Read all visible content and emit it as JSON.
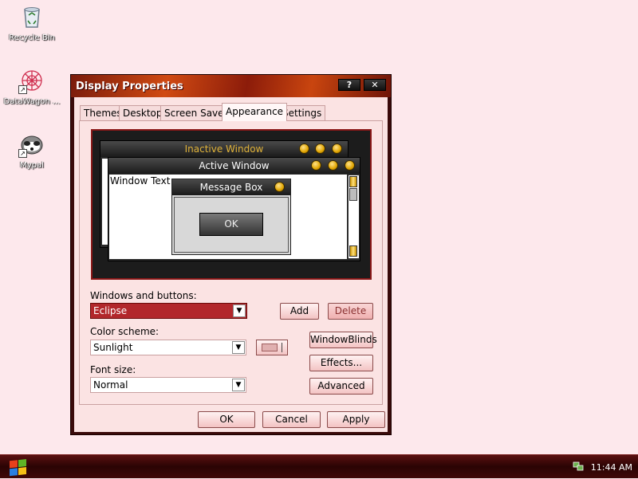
{
  "desktop": {
    "icons": [
      {
        "label": "Recycle Bin",
        "icon": "recycle-bin-icon"
      },
      {
        "label": "DataWagon ...",
        "icon": "datawagon-icon"
      },
      {
        "label": "Mypal",
        "icon": "mypal-icon"
      }
    ]
  },
  "window": {
    "title": "Display Properties",
    "help_label": "?",
    "close_label": "✕",
    "tabs": [
      {
        "label": "Themes"
      },
      {
        "label": "Desktop"
      },
      {
        "label": "Screen Saver"
      },
      {
        "label": "Appearance",
        "active": true
      },
      {
        "label": "Settings"
      }
    ],
    "preview": {
      "inactive_title": "Inactive Window",
      "active_title": "Active Window",
      "window_text": "Window Text",
      "message_box_title": "Message Box",
      "ok_label": "OK"
    },
    "windows_buttons": {
      "label": "Windows and buttons:",
      "value": "Eclipse"
    },
    "color_scheme": {
      "label": "Color scheme:",
      "value": "Sunlight"
    },
    "font_size": {
      "label": "Font size:",
      "value": "Normal"
    },
    "buttons": {
      "add": "Add",
      "delete": "Delete",
      "windowblinds": "WindowBlinds",
      "effects": "Effects...",
      "advanced": "Advanced"
    },
    "footer": {
      "ok": "OK",
      "cancel": "Cancel",
      "apply": "Apply"
    }
  },
  "taskbar": {
    "clock": "11:44 AM"
  },
  "colors": {
    "desktop_bg": "#fde8ec",
    "accent": "#b2272b",
    "taskbar": "#3a0606"
  }
}
